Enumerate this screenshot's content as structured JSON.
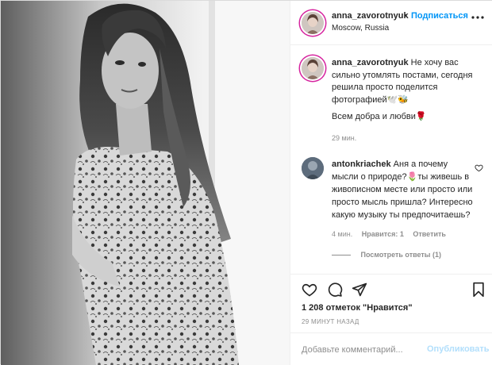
{
  "post": {
    "username": "anna_zavorotnyuk",
    "dot": "•",
    "follow_label": "Подписаться",
    "location": "Moscow, Russia"
  },
  "caption": {
    "username": "anna_zavorotnyuk",
    "text": "Не хочу вас сильно утомлять постами, сегодня решила просто поделится фотографией🕊️🐝",
    "text2": "Всем добра и любви🌹",
    "time": "29 мин."
  },
  "comment": {
    "username": "antonkriachek",
    "text": "Аня а почему мысли о природе?🌷ты живешь в живописном месте или просто или просто мысль пришла? Интересно какую музыку ты предпочитаешь?",
    "time": "4 мин.",
    "like_label": "Нравится: 1",
    "reply_label": "Ответить",
    "view_replies": "Посмотреть ответы (1)"
  },
  "actions": {
    "icons": [
      "heart-icon",
      "comment-icon",
      "share-icon",
      "bookmark-icon"
    ]
  },
  "likes_text": "1 208 отметок \"Нравится\"",
  "posted_ago": "29 МИНУТ НАЗАД",
  "add_comment": {
    "placeholder": "Добавьте комментарий...",
    "publish_label": "Опубликовать"
  },
  "colors": {
    "link": "#0095f6",
    "publish_disabled": "#b2dffc",
    "muted": "#8e8e8e",
    "text": "#262626",
    "story_ring": "#d6249f"
  }
}
